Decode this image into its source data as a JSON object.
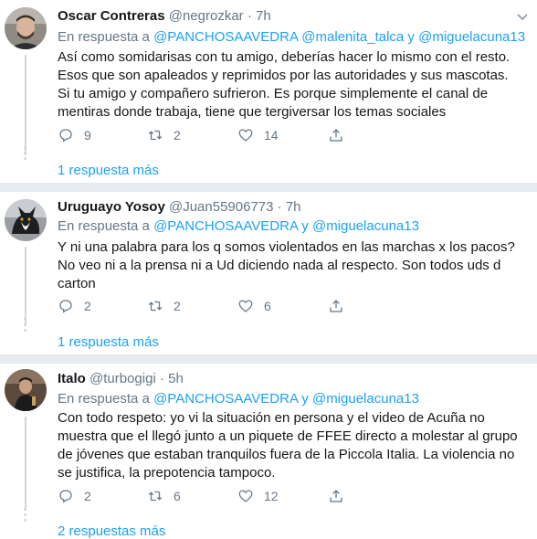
{
  "tweets": [
    {
      "name": "Oscar Contreras",
      "handle": "@negrozkar",
      "separator": "·",
      "time": "7h",
      "reply_prefix": "En respuesta a",
      "mentions": [
        "@PANCHOSAAVEDRA",
        "@malenita_talca",
        "y",
        "@miguelacuna13"
      ],
      "body": "Así como somidarisas con tu amigo, deberías  hacer lo mismo con el resto. Esos que son apaleados y reprimidos por las autoridades y sus mascotas. Si tu amigo y compañero sufrieron. Es porque simplemente el canal de mentiras donde trabaja, tiene que tergiversar los temas sociales",
      "replies": "9",
      "retweets": "2",
      "likes": "14",
      "more": "1 respuesta más"
    },
    {
      "name": "Uruguayo Yosoy",
      "handle": "@Juan55906773",
      "separator": "·",
      "time": "7h",
      "reply_prefix": "En respuesta a",
      "mentions": [
        "@PANCHOSAAVEDRA",
        "y",
        "@miguelacuna13"
      ],
      "body": "Y ni una palabra para los q somos violentados en las marchas x los pacos? No veo ni a la prensa ni a Ud diciendo nada al respecto. Son todos uds d carton",
      "replies": "2",
      "retweets": "2",
      "likes": "6",
      "more": "1 respuesta más"
    },
    {
      "name": "Italo",
      "handle": "@turbogigi",
      "separator": "·",
      "time": "5h",
      "reply_prefix": "En respuesta a",
      "mentions": [
        "@PANCHOSAAVEDRA",
        "y",
        "@miguelacuna13"
      ],
      "body": "Con todo respeto: yo vi la situación en persona y el video de Acuña no muestra que el llegó junto a un piquete de FFEE directo a molestar al grupo de jóvenes que estaban tranquilos fuera de la Piccola Italia. La violencia no se justifica, la prepotencia tampoco.",
      "replies": "2",
      "retweets": "6",
      "likes": "12",
      "more": "2 respuestas más"
    }
  ],
  "icons": {
    "reply": "reply-icon",
    "retweet": "retweet-icon",
    "like": "heart-icon",
    "share": "share-icon",
    "caret": "chevron-down-icon"
  },
  "colors": {
    "link": "#1da1f2",
    "muted": "#657786",
    "text": "#14171a",
    "separator": "#e6ecf0"
  }
}
